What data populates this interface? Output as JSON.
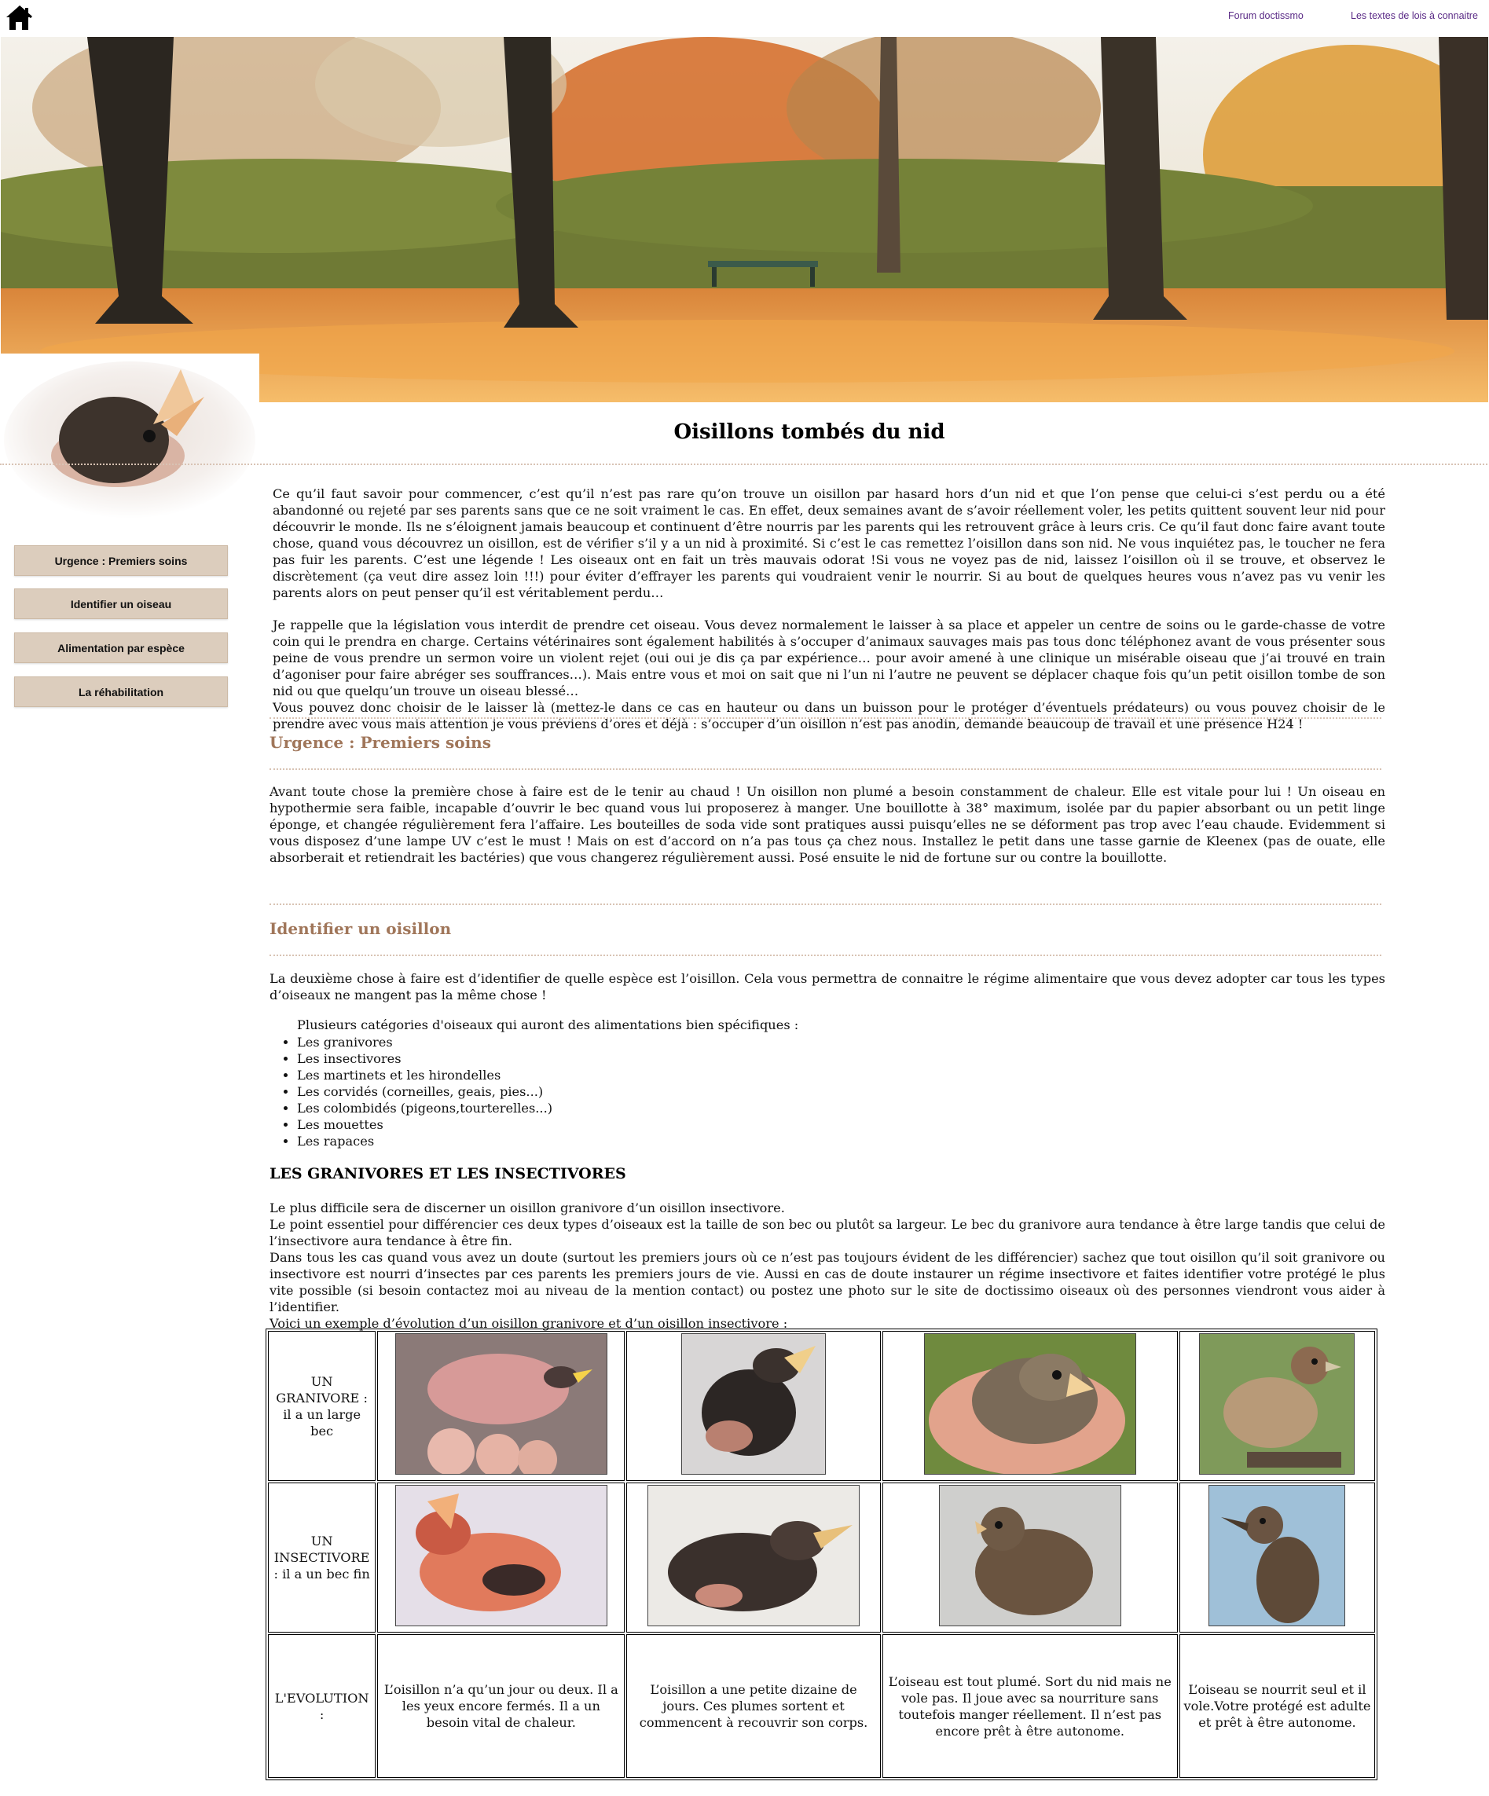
{
  "topbar": {
    "links": [
      "Forum doctissmo",
      "Les textes de lois à connaitre"
    ]
  },
  "sidebar": {
    "items": [
      {
        "label": "Urgence : Premiers soins"
      },
      {
        "label": "Identifier un oiseau"
      },
      {
        "label": "Alimentation par espèce"
      },
      {
        "label": "La réhabilitation"
      }
    ]
  },
  "page": {
    "title": "Oisillons tombés du nid"
  },
  "intro": {
    "p1": "Ce qu’il faut savoir pour commencer, c’est qu’il n’est pas rare qu’on trouve un oisillon par hasard hors d’un nid et que l’on pense que celui-ci s’est perdu ou a été abandonné ou rejeté par ses parents sans que ce ne soit vraiment le cas. En effet, deux semaines avant de s’avoir réellement voler, les petits quittent souvent leur nid pour découvrir le monde. Ils ne s’éloignent jamais beaucoup et continuent d’être nourris par les parents qui les retrouvent grâce à leurs cris. Ce qu’il faut donc faire avant toute chose, quand vous découvrez un oisillon, est de vérifier s’il y a un nid à proximité. Si c’est le cas remettez l’oisillon dans son nid. Ne vous inquiétez pas, le toucher ne fera pas fuir les parents. C’est une légende ! Les oiseaux ont en fait un très mauvais odorat !Si vous ne voyez pas de nid, laissez l’oisillon où il se trouve, et observez le discrètement (ça veut dire assez loin !!!) pour éviter d’effrayer les parents qui voudraient venir le nourrir. Si au bout de quelques heures vous n’avez pas vu venir les parents alors on peut penser qu’il est véritablement perdu…",
    "p2": "Je rappelle que la législation vous interdit de prendre cet oiseau. Vous devez normalement le laisser à sa place et appeler un centre de soins ou le garde-chasse de votre coin qui le prendra en charge. Certains vétérinaires sont également habilités à s’occuper d’animaux sauvages mais pas tous donc téléphonez avant de vous présenter sous peine de vous prendre un sermon voire un violent rejet (oui oui je dis ça par expérience… pour avoir amené à une clinique un misérable oiseau que j’ai trouvé en train d’agoniser pour faire abréger ses souffrances…). Mais entre vous et moi on sait que ni l’un ni l’autre ne peuvent se déplacer chaque fois qu’un petit oisillon tombe de son nid ou que quelqu’un trouve un oiseau blessé…",
    "p3": "Vous pouvez donc choisir de le laisser là (mettez-le dans ce cas en hauteur ou dans un buisson pour le protéger d’éventuels prédateurs) ou vous pouvez choisir de le prendre avec vous mais attention je vous préviens d’ores et déjà : s’occuper d’un oisillon n’est pas anodin, demande beaucoup de travail et une présence H24 !"
  },
  "urgence": {
    "title": "Urgence : Premiers soins",
    "text": "Avant toute chose la première chose à faire est de le tenir au chaud ! Un oisillon non plumé a besoin constamment de chaleur. Elle est vitale pour lui ! Un oiseau en hypothermie sera faible, incapable d’ouvrir le bec quand vous lui proposerez à manger. Une bouillotte à 38° maximum, isolée par du papier absorbant ou un petit linge éponge, et changée régulièrement fera l’affaire. Les bouteilles de soda vide sont pratiques aussi puisqu’elles ne se déforment pas trop avec l’eau chaude. Evidemment si vous disposez d’une lampe UV c’est le must ! Mais on est d’accord on n’a pas tous ça chez nous. Installez le petit dans une tasse garnie de Kleenex (pas de ouate, elle absorberait et retiendrait les bactéries) que vous changerez régulièrement aussi. Posé ensuite le nid de fortune sur ou contre la bouillotte."
  },
  "identifier": {
    "title": "Identifier un oisillon",
    "text": "La deuxième chose à faire est d’identifier de quelle espèce est l’oisillon. Cela vous permettra de connaitre le régime alimentaire que vous devez adopter car tous les types d’oiseaux ne mangent pas la même chose !",
    "list_intro": "Plusieurs catégories d'oiseaux qui auront des alimentations bien spécifiques :",
    "categories": [
      "Les granivores",
      "Les insectivores",
      "Les martinets et les hirondelles",
      "Les corvidés (corneilles, geais, pies...)",
      "Les colombidés (pigeons,tourterelles...)",
      "Les mouettes",
      "Les rapaces"
    ]
  },
  "granivores": {
    "title": "LES GRANIVORES ET LES INSECTIVORES",
    "l1": "Le plus difficile sera de discerner un oisillon granivore d’un oisillon insectivore.",
    "l2": "Le point essentiel pour différencier ces deux types d’oiseaux est la taille de son bec ou plutôt sa largeur. Le bec du granivore aura tendance à être large tandis que celui de l’insectivore aura tendance à être fin.",
    "l3": "Dans tous les cas quand vous avez un doute (surtout les premiers jours où ce n’est pas toujours évident de les différencier) sachez que tout oisillon qu’il soit granivore ou insectivore est nourri d’insectes par ces parents les premiers jours de vie. Aussi en cas de doute instaurer un régime insectivore et faites identifier votre protégé le plus vite possible (si besoin contactez moi au niveau de la mention contact) ou postez une photo sur le site de doctissimo oiseaux où des personnes viendront vous aider à l’identifier.",
    "l4": "Voici un exemple d’évolution d’un oisillon granivore et d’un oisillon insectivore :"
  },
  "table": {
    "row_granivore": "UN GRANIVORE : il a un large bec",
    "row_insectivore": "UN INSECTIVORE : il a un bec fin",
    "row_evolution": "L'EVOLUTION :",
    "evolution": [
      "L’oisillon n’a qu’un jour ou deux. Il a les yeux encore fermés. Il a un besoin vital de chaleur.",
      "L’oisillon a une petite dizaine de jours. Ces plumes sortent et commencent à recouvrir son corps.",
      "L’oiseau est tout plumé. Sort du nid mais ne vole pas. Il joue avec sa nourriture sans toutefois manger réellement. Il n’est pas encore prêt à être autonome.",
      "L’oiseau se nourrit seul et il vole.Votre protégé est adulte et prêt à être autonome."
    ]
  },
  "colors": {
    "accent": "#a0765a",
    "nav_bg": "#dccdbd",
    "link": "#5a2a86"
  }
}
